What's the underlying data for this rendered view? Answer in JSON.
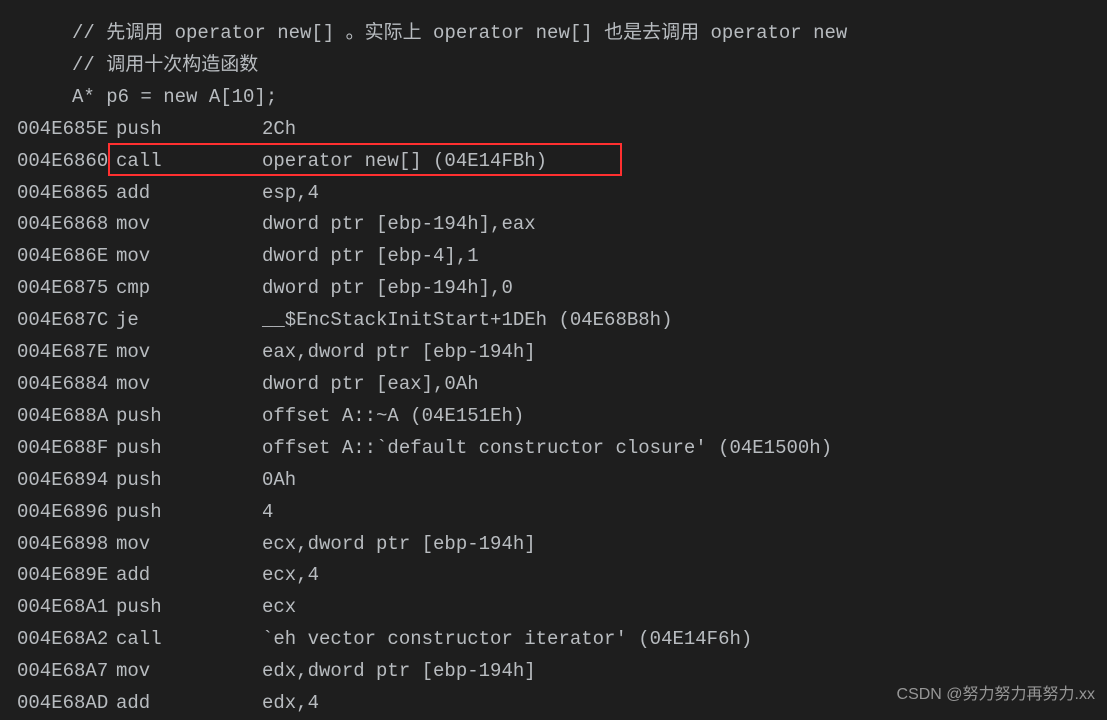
{
  "comments": [
    "// 先调用 operator new[] 。实际上 operator new[] 也是去调用 operator new",
    "// 调用十次构造函数"
  ],
  "source_line": "A* p6 = new A[10];",
  "asm": [
    {
      "addr": "004E685E",
      "mnemonic": "push",
      "operand": "2Ch"
    },
    {
      "addr": "004E6860",
      "mnemonic": "call",
      "operand": "operator new[] (04E14FBh)"
    },
    {
      "addr": "004E6865",
      "mnemonic": "add",
      "operand": "esp,4"
    },
    {
      "addr": "004E6868",
      "mnemonic": "mov",
      "operand": "dword ptr [ebp-194h],eax"
    },
    {
      "addr": "004E686E",
      "mnemonic": "mov",
      "operand": "dword ptr [ebp-4],1"
    },
    {
      "addr": "004E6875",
      "mnemonic": "cmp",
      "operand": "dword ptr [ebp-194h],0"
    },
    {
      "addr": "004E687C",
      "mnemonic": "je",
      "operand": "__$EncStackInitStart+1DEh (04E68B8h)"
    },
    {
      "addr": "004E687E",
      "mnemonic": "mov",
      "operand": "eax,dword ptr [ebp-194h]"
    },
    {
      "addr": "004E6884",
      "mnemonic": "mov",
      "operand": "dword ptr [eax],0Ah"
    },
    {
      "addr": "004E688A",
      "mnemonic": "push",
      "operand": "offset A::~A (04E151Eh)"
    },
    {
      "addr": "004E688F",
      "mnemonic": "push",
      "operand": "offset A::`default constructor closure' (04E1500h)"
    },
    {
      "addr": "004E6894",
      "mnemonic": "push",
      "operand": "0Ah"
    },
    {
      "addr": "004E6896",
      "mnemonic": "push",
      "operand": "4"
    },
    {
      "addr": "004E6898",
      "mnemonic": "mov",
      "operand": "ecx,dword ptr [ebp-194h]"
    },
    {
      "addr": "004E689E",
      "mnemonic": "add",
      "operand": "ecx,4"
    },
    {
      "addr": "004E68A1",
      "mnemonic": "push",
      "operand": "ecx"
    },
    {
      "addr": "004E68A2",
      "mnemonic": "call",
      "operand": "`eh vector constructor iterator' (04E14F6h)"
    },
    {
      "addr": "004E68A7",
      "mnemonic": "mov",
      "operand": "edx,dword ptr [ebp-194h]"
    },
    {
      "addr": "004E68AD",
      "mnemonic": "add",
      "operand": "edx,4"
    }
  ],
  "watermark": "CSDN @努力努力再努力.xx"
}
